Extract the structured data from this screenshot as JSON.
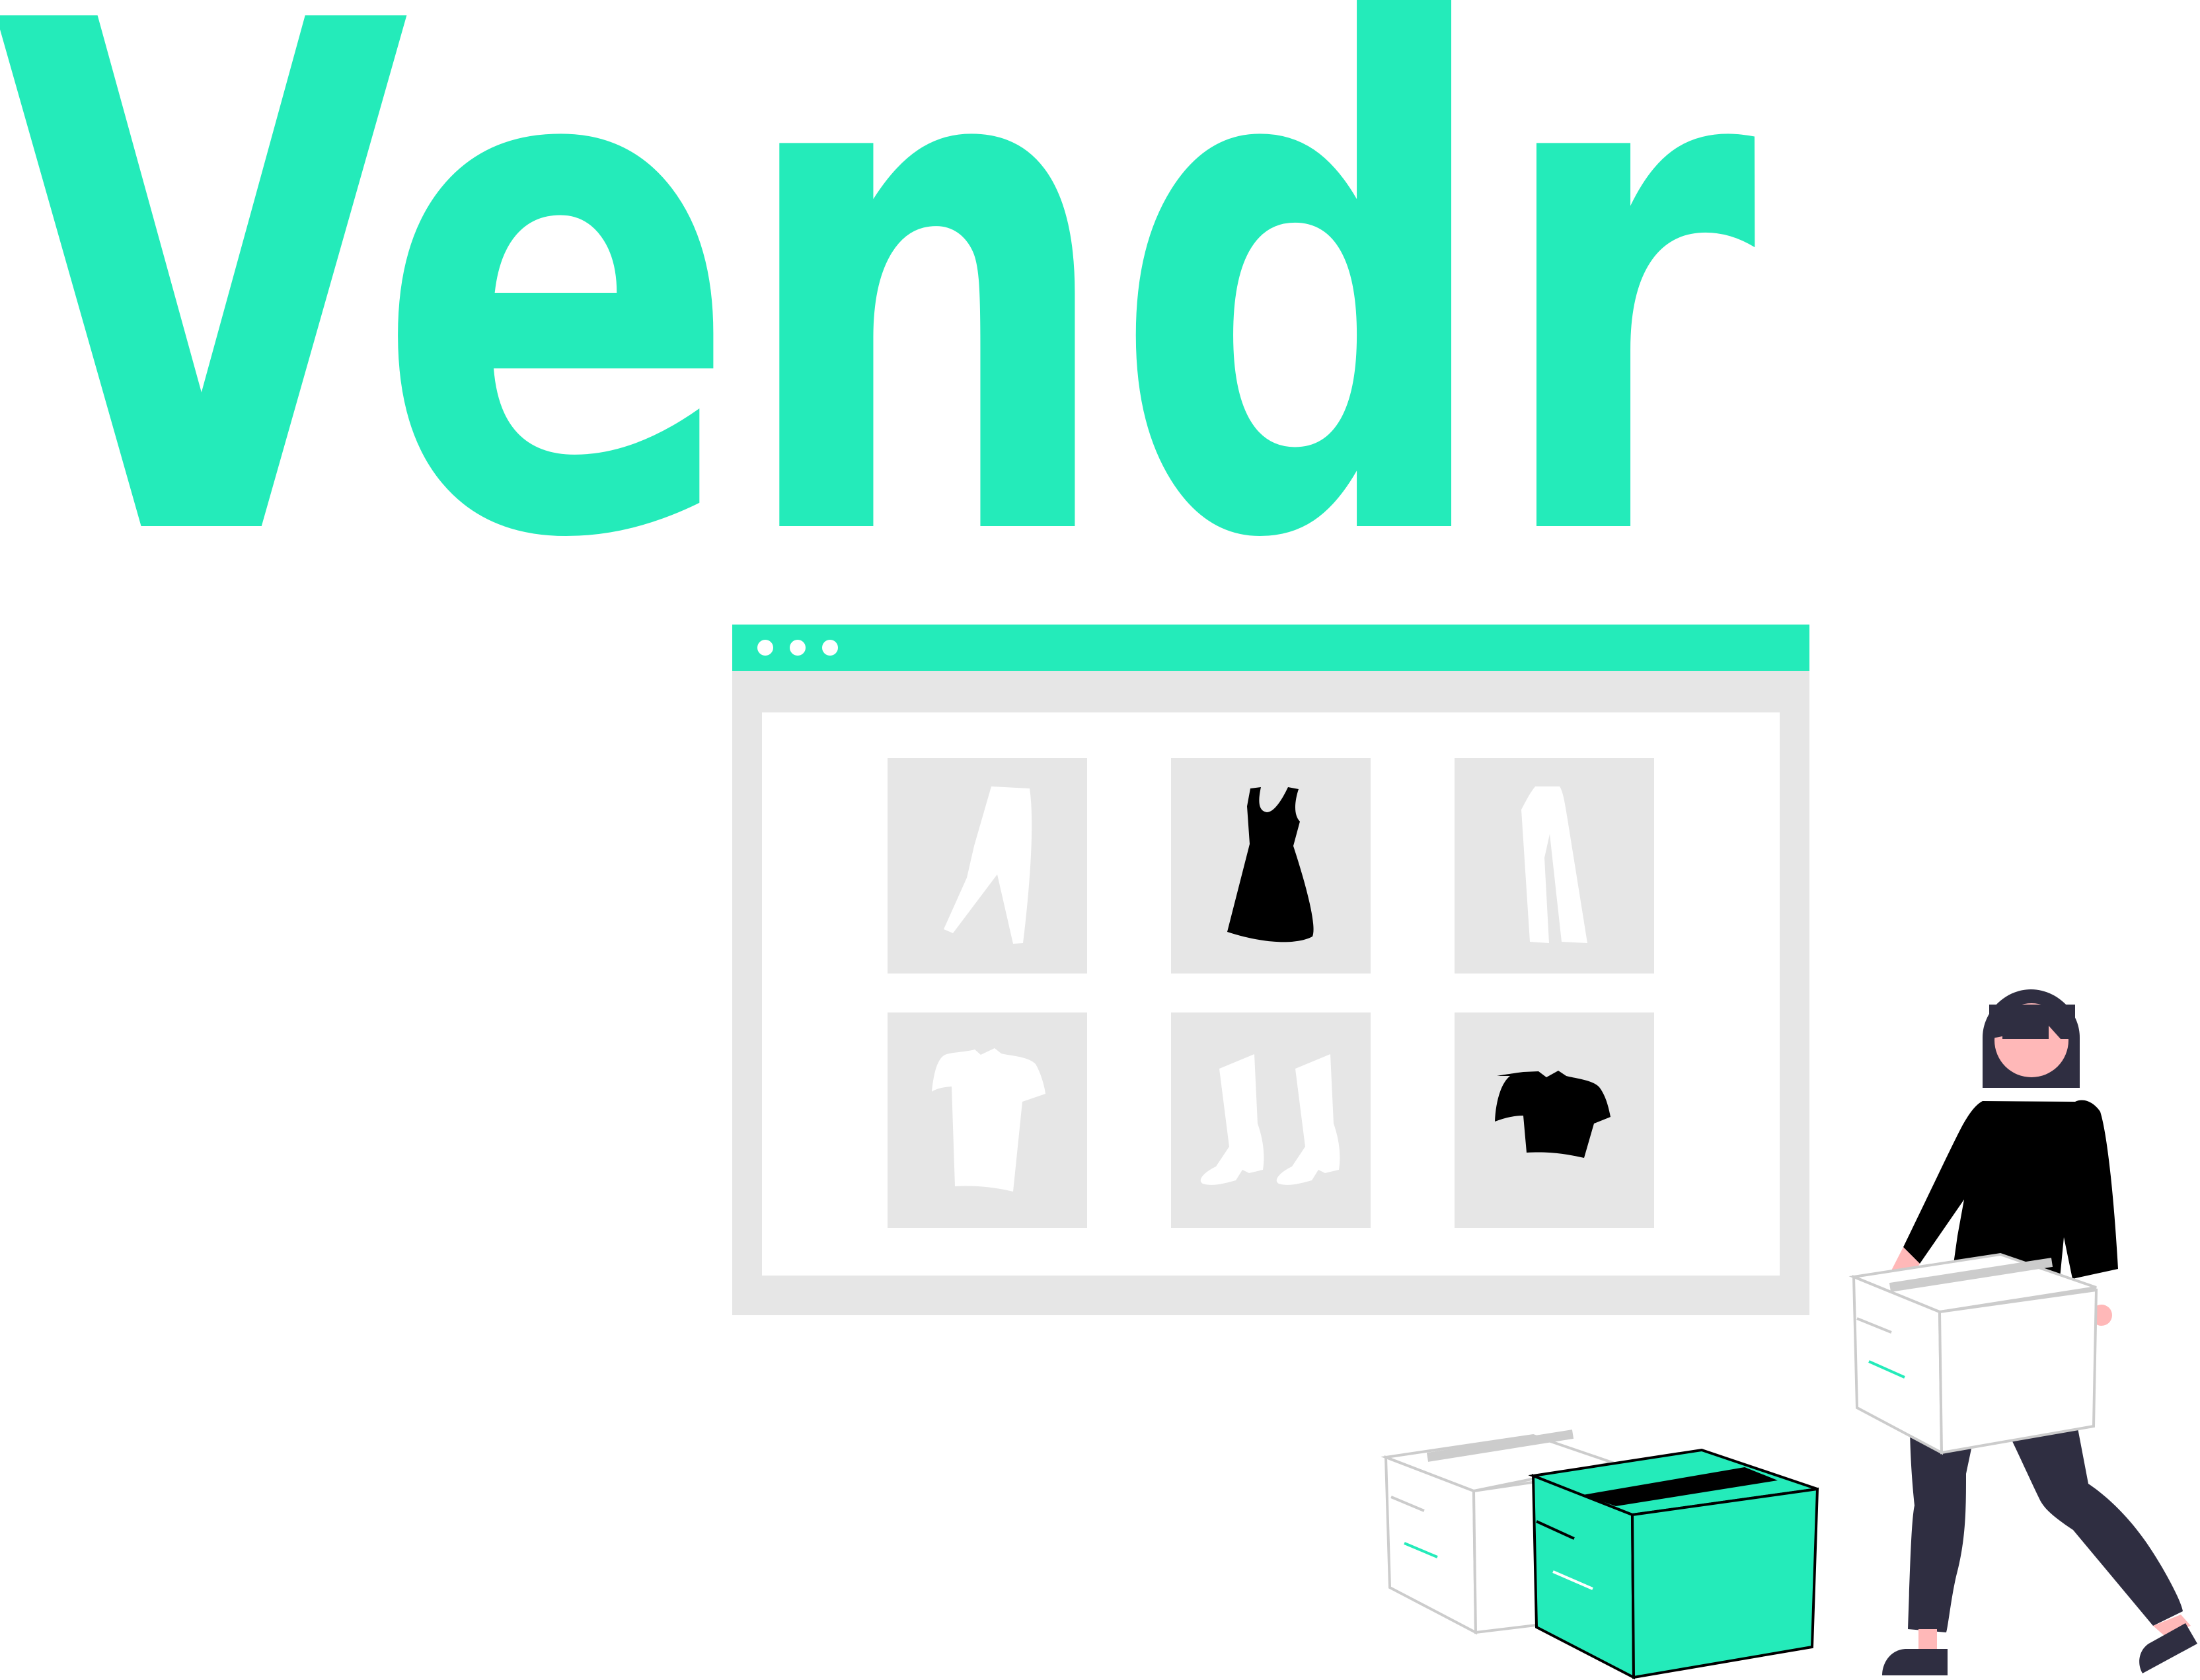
{
  "logo": {
    "text": "Vendr"
  },
  "colors": {
    "accent": "#24EBBA",
    "panel": "#E6E6E6",
    "dark": "#2F2E41",
    "skin": "#FFB8B8",
    "black": "#000000",
    "box_outline": "#CCCCCC"
  },
  "browser": {
    "window_dots": [
      "window-dot-1",
      "window-dot-2",
      "window-dot-3"
    ],
    "products": [
      {
        "name": "pants",
        "fill": "white"
      },
      {
        "name": "dress",
        "fill": "black"
      },
      {
        "name": "trousers",
        "fill": "white"
      },
      {
        "name": "shirt",
        "fill": "white"
      },
      {
        "name": "socks",
        "fill": "white"
      },
      {
        "name": "t-shirt",
        "fill": "black"
      }
    ]
  },
  "illustration": {
    "figures": [
      "person-carrying-box",
      "white-box",
      "green-box"
    ]
  }
}
